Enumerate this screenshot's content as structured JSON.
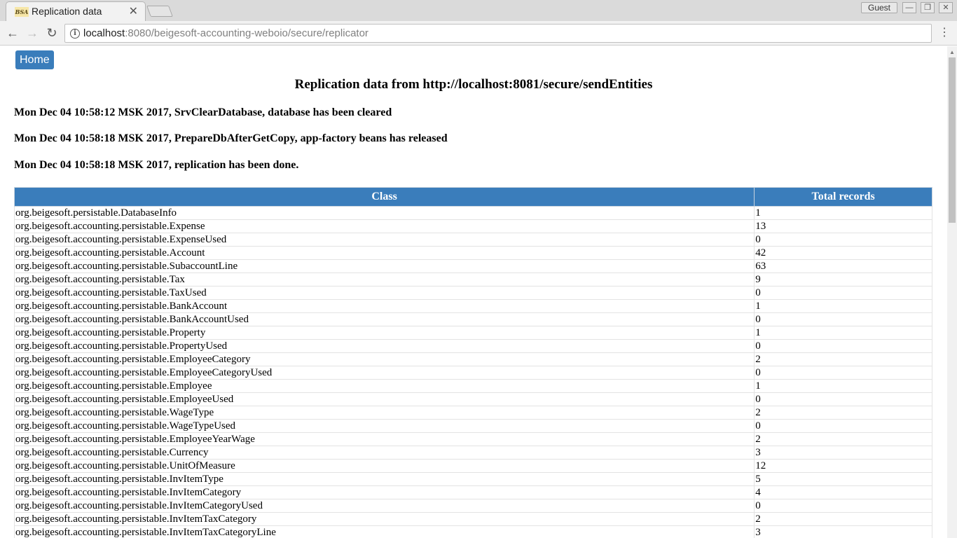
{
  "browser": {
    "tab_title": "Replication data",
    "favicon_text": "BSA",
    "close_glyph": "✕",
    "profile_label": "Guest",
    "url_host": "localhost",
    "url_rest": ":8080/beigesoft-accounting-weboio/secure/replicator"
  },
  "icons": {
    "back": "←",
    "forward": "→",
    "reload": "↻",
    "info": "i",
    "menu": "⋮",
    "minimize": "—",
    "restore": "❐",
    "close": "✕",
    "scroll_up": "▲"
  },
  "page": {
    "home_label": "Home",
    "title": "Replication data from http://localhost:8081/secure/sendEntities",
    "log": [
      "Mon Dec 04 10:58:12 MSK 2017, SrvClearDatabase, database has been cleared",
      "Mon Dec 04 10:58:18 MSK 2017, PrepareDbAfterGetCopy, app-factory beans has released",
      "Mon Dec 04 10:58:18 MSK 2017, replication has been done."
    ],
    "table": {
      "headers": [
        "Class",
        "Total records"
      ],
      "rows": [
        [
          "org.beigesoft.persistable.DatabaseInfo",
          "1"
        ],
        [
          "org.beigesoft.accounting.persistable.Expense",
          "13"
        ],
        [
          "org.beigesoft.accounting.persistable.ExpenseUsed",
          "0"
        ],
        [
          "org.beigesoft.accounting.persistable.Account",
          "42"
        ],
        [
          "org.beigesoft.accounting.persistable.SubaccountLine",
          "63"
        ],
        [
          "org.beigesoft.accounting.persistable.Tax",
          "9"
        ],
        [
          "org.beigesoft.accounting.persistable.TaxUsed",
          "0"
        ],
        [
          "org.beigesoft.accounting.persistable.BankAccount",
          "1"
        ],
        [
          "org.beigesoft.accounting.persistable.BankAccountUsed",
          "0"
        ],
        [
          "org.beigesoft.accounting.persistable.Property",
          "1"
        ],
        [
          "org.beigesoft.accounting.persistable.PropertyUsed",
          "0"
        ],
        [
          "org.beigesoft.accounting.persistable.EmployeeCategory",
          "2"
        ],
        [
          "org.beigesoft.accounting.persistable.EmployeeCategoryUsed",
          "0"
        ],
        [
          "org.beigesoft.accounting.persistable.Employee",
          "1"
        ],
        [
          "org.beigesoft.accounting.persistable.EmployeeUsed",
          "0"
        ],
        [
          "org.beigesoft.accounting.persistable.WageType",
          "2"
        ],
        [
          "org.beigesoft.accounting.persistable.WageTypeUsed",
          "0"
        ],
        [
          "org.beigesoft.accounting.persistable.EmployeeYearWage",
          "2"
        ],
        [
          "org.beigesoft.accounting.persistable.Currency",
          "3"
        ],
        [
          "org.beigesoft.accounting.persistable.UnitOfMeasure",
          "12"
        ],
        [
          "org.beigesoft.accounting.persistable.InvItemType",
          "5"
        ],
        [
          "org.beigesoft.accounting.persistable.InvItemCategory",
          "4"
        ],
        [
          "org.beigesoft.accounting.persistable.InvItemCategoryUsed",
          "0"
        ],
        [
          "org.beigesoft.accounting.persistable.InvItemTaxCategory",
          "2"
        ],
        [
          "org.beigesoft.accounting.persistable.InvItemTaxCategoryLine",
          "3"
        ]
      ]
    }
  }
}
